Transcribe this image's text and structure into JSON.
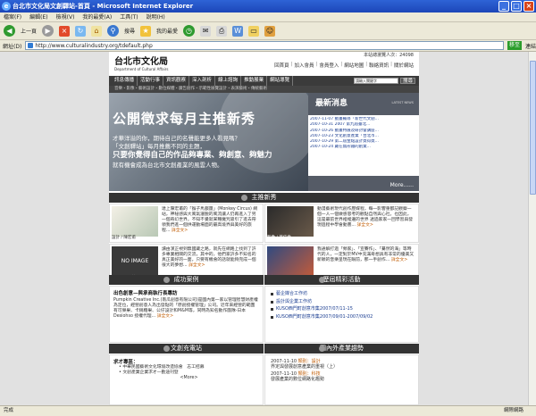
{
  "window": {
    "title": "台北市文化局文創驛站-首頁 - Microsoft Internet Explorer"
  },
  "menu": [
    "檔案(F)",
    "編輯(E)",
    "檢視(V)",
    "我的最愛(A)",
    "工具(T)",
    "說明(H)"
  ],
  "toolbar": {
    "back": "上一頁",
    "search": "搜尋",
    "favorites": "我的最愛"
  },
  "address": {
    "label": "網址(D)",
    "url": "http://www.culturalindustry.org/tdefault.php",
    "go": "移至",
    "links": "連結"
  },
  "site": {
    "logo_cn": "台北市文化局",
    "logo_en": "Department of Cultural Affairs",
    "counter": "本站總瀏覽人次：24098",
    "toplinks": [
      "回首頁",
      "加入會員",
      "會員登入",
      "網站地圖",
      "聯絡資訊",
      "關於網站"
    ],
    "nav": [
      "訊息傳播",
      "活動行事",
      "資訊觀察",
      "深入剖析",
      "線上諮詢",
      "推動展業",
      "網站導覽"
    ],
    "search_placeholder": "請輸入關鍵字",
    "search_btn": "搜尋",
    "subnav": "音樂・影像・藝術設計・數位媒體・廣告創作・示範性展覽設計・表演藝術・傳統藝術"
  },
  "hero": {
    "title": "公開徵求每月主推新秀",
    "l1": "才華洋溢的你，期待自己的名聲能更多人看見嗎？",
    "l2": "「文創驛站」每月推薦不同的主題，",
    "l3": "只要你覺得自己的作品夠專業、夠創意、夠魅力",
    "l4": "就有機會成為台北市文創產業的風雲人物。"
  },
  "news": {
    "heading": "最新消息",
    "heading_en": "LATEST NEWS",
    "items": [
      "2007-11-07 動畫輔導「新世代文創...",
      "2007-10-31 2007 第九屆臺北...",
      "2007-10-26 動畫特展及研討會講座...",
      "2007-10-23 文化創意產業「台北市...",
      "2007-10-29 第二屆金點設計獎得獎...",
      "2007-10-24 藏在無形鐵的創業..."
    ],
    "more": "More......"
  },
  "featured": {
    "heading": "主推新秀",
    "cells": [
      {
        "caption": "設計 / 陳宏甫",
        "text": "達上陳宏甫的「猴子馬戲團」(Monkey Circus) 網站，神秘感與大風氣灑脫的風流讓人仍再進入了另一個奇幻世界，不知不覺就某種魔咒吸引了進去帶領我們進一個供運動場面的最高境界與美好的旅程... ",
        "readmore": "詳全文>"
      },
      {
        "caption": "影像 / 黃信堯",
        "text": "動漫藝術現代創作歷媒程，每一影響重都記觀察一個一人一個做感思考的觀點自然與心社。也因此，這是最前世界裡裡邊的世界 透過家家一回學習與發現過程中學會動畫... ",
        "readmore": "詳全文>"
      },
      {
        "caption": "動畫 / 吳惠蓉",
        "text": "讀由漢正視到無國藏之路，就先在網路上找到了許多專業相關的交流，其中的，他們家許多不知名的真正美好的一面，只要有機會的話就能夠完成一個很大的夢想... ",
        "readmore": "詳全文>"
      },
      {
        "caption": "設計 / 陳家鋒",
        "text": "我通解打過「頻家」、「宣賽作」、「驀然的海」等時代的人，一定對於MV中充滿奇想具有非常的優美又新穎的音樂呈現在眼前，那一手創作... ",
        "readmore": "詳全文>"
      }
    ],
    "noimage": "NO IMAGE"
  },
  "cases": {
    "heading": "成功案例",
    "title": "出色創意—與承商執行長專訪",
    "body": "Pumpkin Creative Inc.(南瓜創意有限公司)是國內第一家以管理智慧財產權為定位，經營創意人為出發點的「原創授權管理」公司。近年來經營的範圍有可樂果、卡稱糖果、公仔設計和M&M等，同時為知名動作團隊-日本Desiohso 授權代理... ",
    "readmore": "詳全文>"
  },
  "works": {
    "heading": "歷屆精彩活動",
    "items": [
      "藝企媒合工作坊",
      "設計與企業工作坊",
      "KUSO西門町創意市集2007/07/11-15",
      "KUSO西門町創意市集2007/09/01-2007/09/02"
    ]
  },
  "docs": {
    "heading": "文創充電站",
    "title": "求才專區：",
    "items": [
      "• 中華民國藝術文化環境改造協會　志工招募",
      "• 文創產業企業求才—勤途刊登"
    ],
    "more": "<More>"
  },
  "intl": {
    "heading": "國內外產業趨勢",
    "entries": [
      {
        "date": "2007-11-10",
        "cat": "類別：設計",
        "title": "界定與發展創意產業的重視（上）"
      },
      {
        "date": "2007-11-10",
        "cat": "類別：科技",
        "title": "發展產業的數位網路化趨勢"
      }
    ]
  },
  "status": {
    "text": "完成",
    "zone": "網際網路"
  }
}
